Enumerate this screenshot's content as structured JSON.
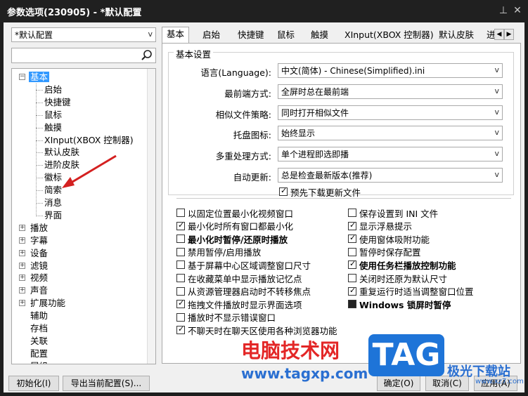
{
  "window": {
    "title": "参数选项(230905) - *默认配置",
    "pin_icon": "pin-icon",
    "close_icon": "close-icon"
  },
  "left": {
    "profile": "*默认配置",
    "search_placeholder": "",
    "tree": {
      "root": "基本",
      "children": [
        "启始",
        "快捷键",
        "鼠标",
        "触摸",
        "XInput(XBOX 控制器)",
        "默认皮肤",
        "进阶皮肤",
        "徽标",
        "简索",
        "消息",
        "界面"
      ],
      "groups": [
        "播放",
        "字幕",
        "设备",
        "滤镜",
        "视频",
        "声音",
        "扩展功能"
      ],
      "leaves": [
        "辅助",
        "存档",
        "关联",
        "配置",
        "属组"
      ]
    }
  },
  "tabs": [
    "基本",
    "启始",
    "快捷键",
    "鼠标",
    "触摸",
    "XInput(XBOX 控制器)",
    "默认皮肤",
    "进"
  ],
  "basic": {
    "group_title": "基本设置",
    "rows": [
      {
        "label": "语言(Language):",
        "value": "中文(简体) - Chinese(Simplified).ini"
      },
      {
        "label": "最前端方式:",
        "value": "全屏时总在最前端"
      },
      {
        "label": "相似文件策略:",
        "value": "同时打开相似文件"
      },
      {
        "label": "托盘图标:",
        "value": "始终显示"
      },
      {
        "label": "多重处理方式:",
        "value": "单个进程即选即播"
      },
      {
        "label": "自动更新:",
        "value": "总是检查最新版本(推荐)"
      }
    ],
    "predownload": "预先下载更新文件"
  },
  "options_left": [
    "以固定位置最小化视频窗口",
    "最小化时所有窗口都最小化",
    "最小化时暂停/还原时播放",
    "禁用暂停/启用播放",
    "基于屏幕中心区域调整窗口尺寸",
    "在收藏菜单中显示播放记忆点",
    "从资源管理器启动时不转移焦点",
    "拖拽文件播放时显示界面选项",
    "播放时不显示错误窗口",
    "不聊天时在聊天区使用各种浏览器功能"
  ],
  "options_right": [
    "保存设置到 INI 文件",
    "显示浮悬提示",
    "使用窗体吸附功能",
    "暂停时保存配置",
    "使用任务栏播放控制功能",
    "关闭时还原为默认尺寸",
    "重复运行时适当调整窗口位置",
    "Windows 锁屏时暂停"
  ],
  "buttons": {
    "init": "初始化(I)",
    "export": "导出当前配置(S)...",
    "ok": "确定(O)",
    "cancel": "取消(C)",
    "apply": "应用(A)"
  },
  "watermark": {
    "site_name": "电脑技术网",
    "site_url": "www.tagxp.com",
    "logo": "TAG",
    "brand": "极光下载站",
    "brand_url": "www.xz7.com"
  }
}
